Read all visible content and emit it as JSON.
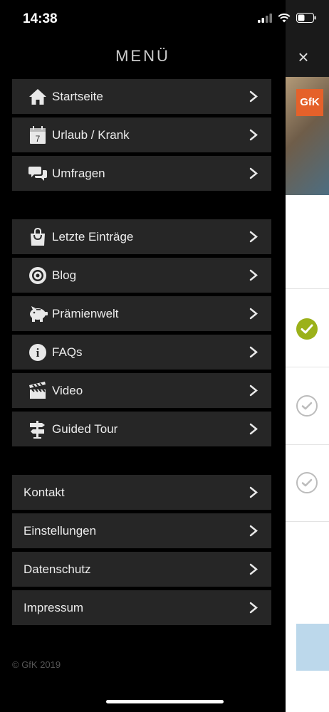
{
  "status_bar": {
    "time": "14:38"
  },
  "menu": {
    "title": "MENÜ",
    "group1": [
      {
        "label": "Startseite",
        "icon": "home-icon"
      },
      {
        "label": "Urlaub / Krank",
        "icon": "calendar-icon",
        "icon_text": "7"
      },
      {
        "label": "Umfragen",
        "icon": "chat-bubbles-icon"
      }
    ],
    "group2": [
      {
        "label": "Letzte Einträge",
        "icon": "shopping-bag-icon"
      },
      {
        "label": "Blog",
        "icon": "eye-icon"
      },
      {
        "label": "Prämienwelt",
        "icon": "piggy-bank-icon"
      },
      {
        "label": "FAQs",
        "icon": "info-icon",
        "icon_text": "i"
      },
      {
        "label": "Video",
        "icon": "clapperboard-icon"
      },
      {
        "label": "Guided Tour",
        "icon": "signpost-icon"
      }
    ],
    "group3": [
      {
        "label": "Kontakt"
      },
      {
        "label": "Einstellungen"
      },
      {
        "label": "Datenschutz"
      },
      {
        "label": "Impressum"
      }
    ],
    "copyright": "© GfK 2019"
  },
  "background_app": {
    "logo": "GfK",
    "close_glyph": "×",
    "accent": "#9bb11a",
    "logo_color": "#e5612a"
  }
}
